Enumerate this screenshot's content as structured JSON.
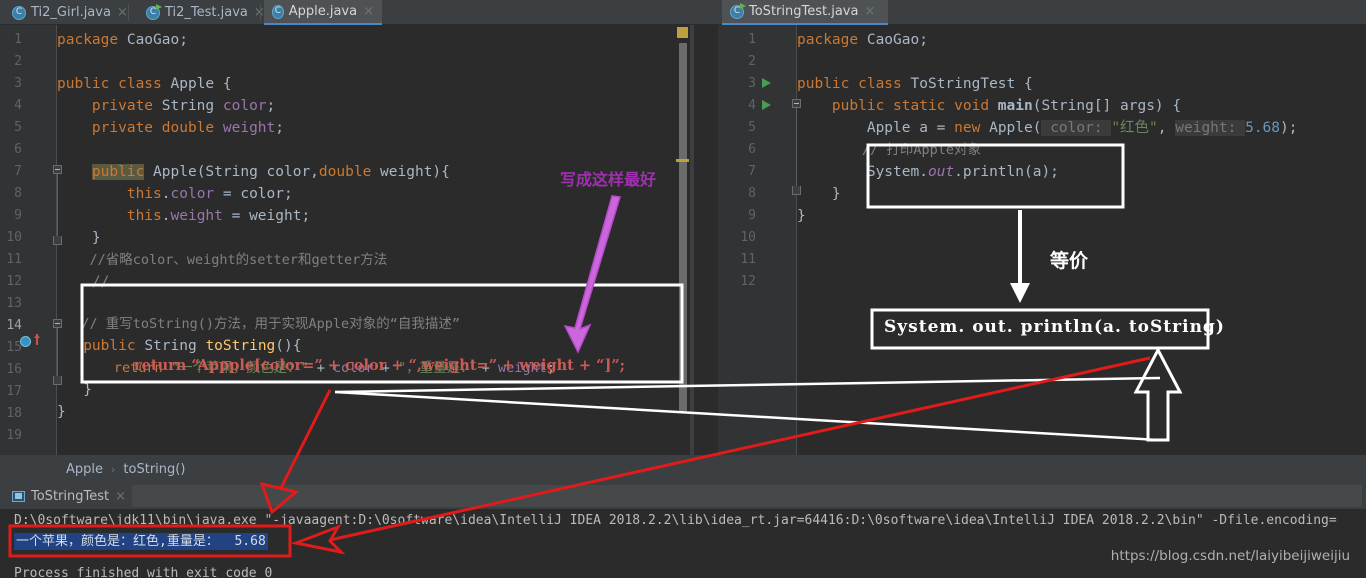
{
  "window": {
    "theme_bg": "#2b2b2b",
    "accent": "#4a88c7"
  },
  "tabs": {
    "left_group": [
      {
        "label": "Ti2_Girl.java",
        "icon": "java-class-icon",
        "active": false,
        "close": "×"
      },
      {
        "label": "Ti2_Test.java",
        "icon": "java-runnable-class-icon",
        "active": false,
        "close": "×"
      },
      {
        "label": "Apple.java",
        "icon": "java-class-icon",
        "active": true,
        "close": "×"
      }
    ],
    "right_group": [
      {
        "label": "ToStringTest.java",
        "icon": "java-runnable-class-icon",
        "active": true,
        "close": "×"
      }
    ]
  },
  "editor_left": {
    "file": "Apple.java",
    "line_numbers": [
      "1",
      "2",
      "3",
      "4",
      "5",
      "6",
      "7",
      "8",
      "9",
      "10",
      "11",
      "12",
      "13",
      "14",
      "15",
      "16",
      "17",
      "18",
      "19"
    ],
    "lines": [
      "package CaoGao;",
      "",
      "public class Apple {",
      "    private String color;",
      "    private double weight;",
      "",
      "    public Apple(String color,double weight){",
      "        this.color = color;",
      "        this.weight = weight;",
      "    }",
      "    //省略color、weight的setter和getter方法",
      "    //...",
      "    // 重写toString()方法，用于实现Apple对象的“自我描述”",
      "    public String toString(){",
      "        return \"一个苹果，颜色是：\" + color + \"，重量是：\" + weight;",
      "    }",
      "}",
      "",
      ""
    ]
  },
  "editor_right": {
    "file": "ToStringTest.java",
    "line_numbers": [
      "1",
      "2",
      "3",
      "4",
      "5",
      "6",
      "7",
      "8",
      "9",
      "10",
      "11",
      "12"
    ],
    "lines": [
      "package CaoGao;",
      "",
      "public class ToStringTest {",
      "    public static void main(String[] args) {",
      "        Apple a = new Apple( color: \"红色\", weight: 5.68);",
      "        // 打印Apple对象",
      "        System.out.println(a);",
      "    }",
      "}",
      "",
      "",
      ""
    ],
    "param_hints": [
      "color:",
      "weight:"
    ]
  },
  "breadcrumb": {
    "items": [
      "Apple",
      "toString()"
    ],
    "separator": "›"
  },
  "console": {
    "tab_label": "ToStringTest",
    "tab_icon": "run-configuration-icon",
    "tab_close": "×",
    "lines": [
      "D:\\0software\\jdk11\\bin\\java.exe \"-javaagent:D:\\0software\\idea\\IntelliJ IDEA 2018.2.2\\lib\\idea_rt.jar=64416:D:\\0software\\idea\\IntelliJ IDEA 2018.2.2\\bin\" -Dfile.encoding=",
      "一个苹果，颜色是：红色,重量是：  5.68",
      "Process finished with exit code 0"
    ],
    "selected_line_index": 1,
    "selection_color": "#214283"
  },
  "watermark": "https://blog.csdn.net/laiyibeijiweijiu",
  "annotations": {
    "purple_note": "写成这样最好",
    "equiv_note": "等价",
    "handwritten_return": "return “Appple[color=” + color + “,weight=” + weight + “]”;",
    "boxed_statement": "System. out. println(a. toString)",
    "colors": {
      "purple": "#a030b0",
      "white": "#ffffff",
      "red": "#e01b1b",
      "handwrite_red": "#cc5a55"
    }
  }
}
